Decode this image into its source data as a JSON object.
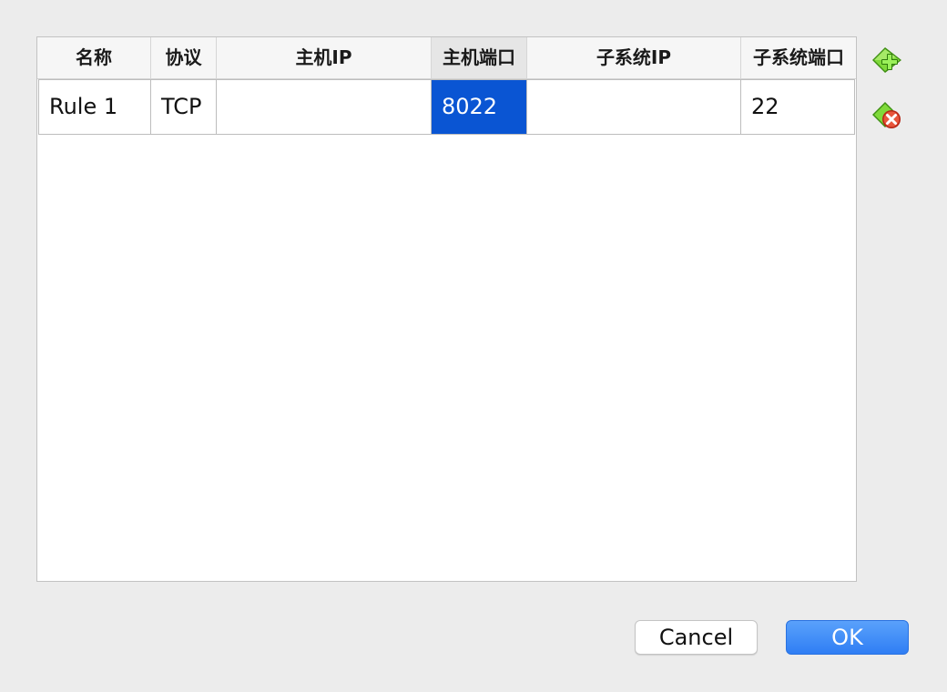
{
  "table": {
    "headers": [
      "名称",
      "协议",
      "主机IP",
      "主机端口",
      "子系统IP",
      "子系统端口"
    ],
    "sorted_column": "主机端口",
    "rows": [
      {
        "name": "Rule 1",
        "protocol": "TCP",
        "host_ip": "",
        "host_port": "8022",
        "guest_ip": "",
        "guest_port": "22"
      }
    ],
    "selected_cell": "host_port"
  },
  "side_icons": {
    "add": "add-rule-icon",
    "remove": "remove-rule-icon"
  },
  "buttons": {
    "cancel_label": "Cancel",
    "ok_label": "OK"
  },
  "colors": {
    "selection": "#0a55d3",
    "ok_button": "#3b86f7",
    "add_icon": "#5cc21f",
    "remove_icon": "#e2452f"
  }
}
